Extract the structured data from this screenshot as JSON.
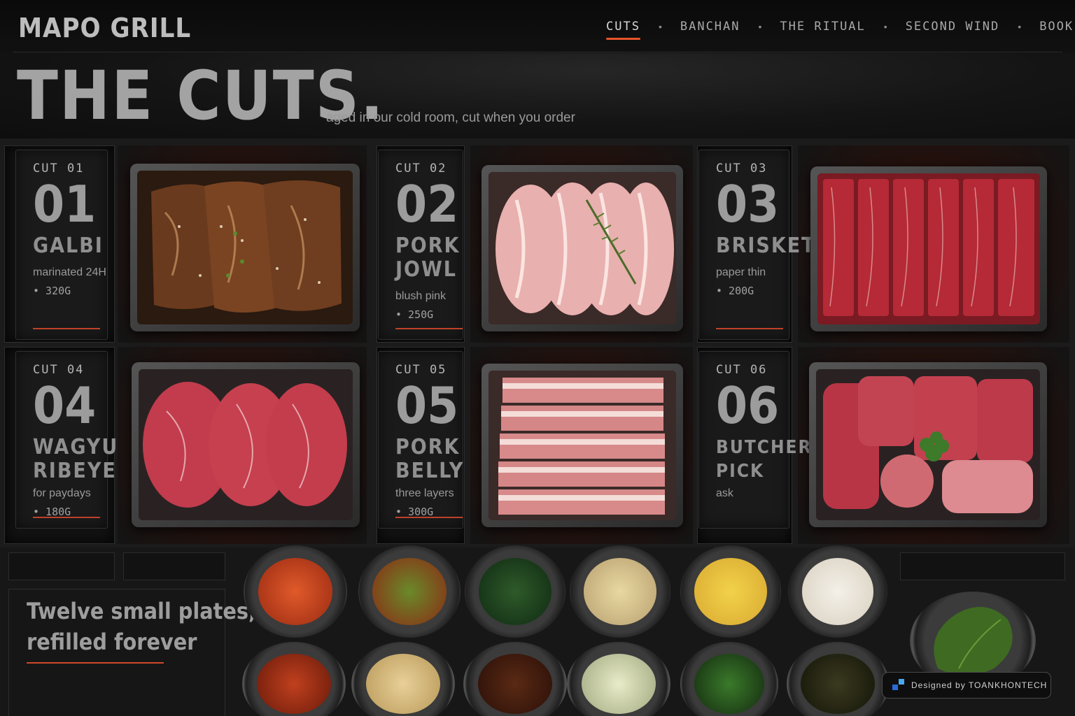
{
  "brand": {
    "name": "MAPO GRILL"
  },
  "nav": {
    "items": [
      {
        "label": "CUTS",
        "active": true
      },
      {
        "label": "BANCHAN"
      },
      {
        "label": "THE RITUAL"
      },
      {
        "label": "SECOND WIND"
      },
      {
        "label": "BOOK"
      }
    ],
    "separator": "•"
  },
  "hero": {
    "title": "THE CUTS.",
    "subtitle": "aged in our cold room, cut when you order"
  },
  "cuts": [
    {
      "tag": "CUT 01",
      "number": "01",
      "name": "GALBI",
      "note": "marinated 24H",
      "weight": "• 320G"
    },
    {
      "tag": "CUT 02",
      "number": "02",
      "name": "PORK JOWL",
      "note": "blush pink",
      "weight": "• 250G"
    },
    {
      "tag": "CUT 03",
      "number": "03",
      "name": "BRISKET",
      "note": "paper thin",
      "weight": "• 200G"
    },
    {
      "tag": "CUT 04",
      "number": "04",
      "name": "WAGYU RIBEYE",
      "note": "for paydays",
      "weight": "• 180G"
    },
    {
      "tag": "CUT 05",
      "number": "05",
      "name": "PORK BELLY",
      "note": "three layers",
      "weight": "• 300G"
    },
    {
      "tag": "CUT 06",
      "number": "06",
      "name": "BUTCHER'S PICK",
      "note": "ask",
      "weight": ""
    }
  ],
  "banchan": {
    "text_line1": "Twelve small plates,",
    "text_line2": "refilled forever"
  },
  "credit": {
    "text": "Designed by TOANKHONTECH"
  },
  "colors": {
    "accent": "#e8532a",
    "background": "#0d0d0d",
    "text": "#b8b8b8"
  }
}
